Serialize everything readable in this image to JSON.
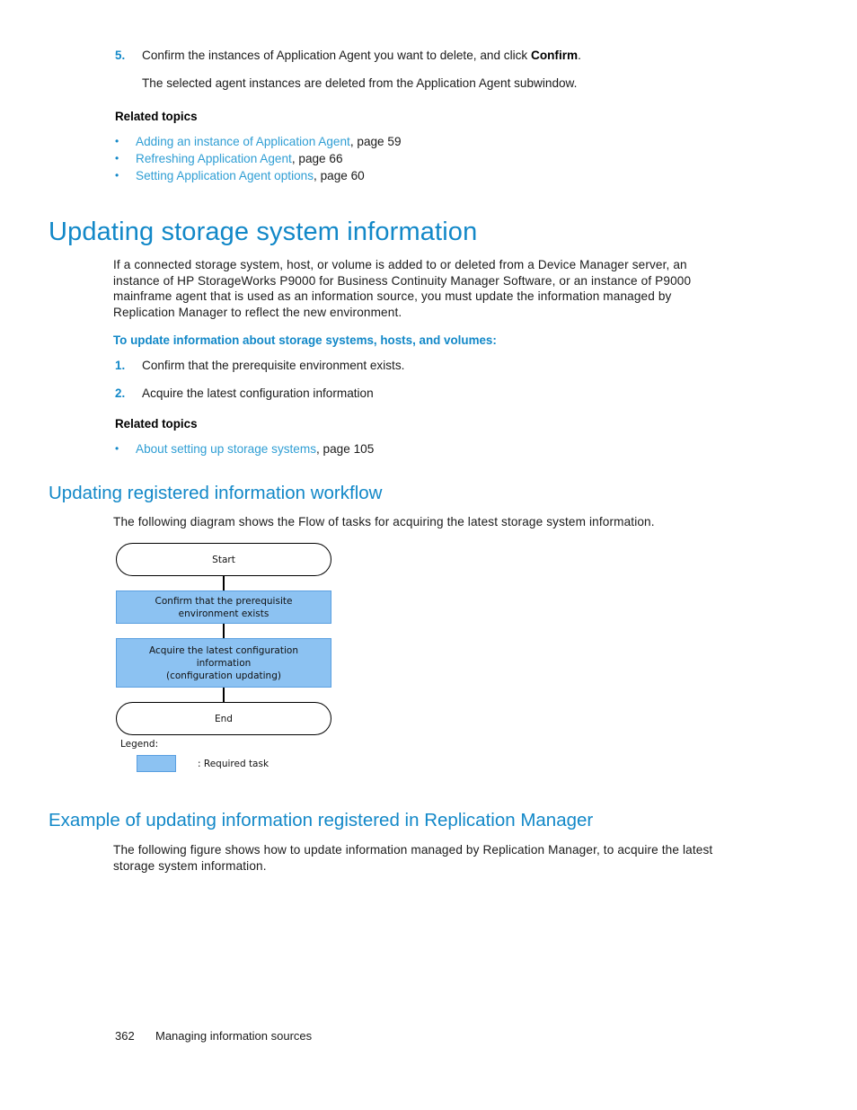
{
  "document": {
    "step5": {
      "number": "5.",
      "text_before": "Confirm the instances of Application Agent you want to delete, and click ",
      "bold": "Confirm",
      "text_after": ".",
      "result": "The selected agent instances are deleted from the Application Agent subwindow."
    },
    "related_topics_label_1": "Related topics",
    "related_links_1": [
      {
        "bullet": "•",
        "title": "Adding an instance of Application Agent",
        "page": ", page 59"
      },
      {
        "bullet": "•",
        "title": "Refreshing Application Agent",
        "page": ", page 66"
      },
      {
        "bullet": "•",
        "title": "Setting Application Agent options",
        "page": ", page 60"
      }
    ],
    "heading_main": "Updating storage system information",
    "intro_paragraph": "If a connected storage system, host, or volume is added to or deleted from a Device Manager server, an instance of HP StorageWorks P9000 for Business Continuity Manager Software, or an instance of P9000 mainframe agent that is used as an information source, you must update the information managed by Replication Manager to reflect the new environment.",
    "procedure_heading": "To update information about storage systems, hosts, and volumes:",
    "procedure_steps": [
      {
        "number": "1.",
        "text": "Confirm that the prerequisite environment exists."
      },
      {
        "number": "2.",
        "text": "Acquire the latest configuration information"
      }
    ],
    "related_topics_label_2": "Related topics",
    "related_links_2": [
      {
        "bullet": "•",
        "title": "About setting up storage systems",
        "page": ", page 105"
      }
    ],
    "heading_workflow": "Updating registered information workflow",
    "workflow_intro": "The following diagram shows the Flow of tasks for acquiring the latest storage system information.",
    "heading_example": "Example of updating information registered in Replication Manager",
    "example_intro": "The following figure shows how to update information managed by Replication Manager, to acquire the latest storage system information."
  },
  "flowchart": {
    "nodes": [
      {
        "id": "start",
        "label": "Start",
        "shape": "terminal"
      },
      {
        "id": "task1",
        "label": "Confirm that the prerequisite\nenvironment exists",
        "shape": "task"
      },
      {
        "id": "task2",
        "label": "Acquire the latest configuration\ninformation\n(configuration updating)",
        "shape": "task"
      },
      {
        "id": "end",
        "label": "End",
        "shape": "terminal"
      }
    ],
    "node_start": "Start",
    "node_task1_line1": "Confirm that the prerequisite",
    "node_task1_line2": "environment exists",
    "node_task2_line1": "Acquire the latest configuration",
    "node_task2_line2": "information",
    "node_task2_line3": "(configuration updating)",
    "node_end": "End",
    "legend_title": "Legend:",
    "legend_label": ": Required task"
  },
  "footer": {
    "page_number": "362",
    "section": "Managing information sources"
  },
  "colors": {
    "heading_blue": "#1288c8",
    "link_blue": "#2f9ed4",
    "task_fill": "#8cc2f2",
    "task_border": "#5a9fe0",
    "text": "#1a1a1a"
  }
}
